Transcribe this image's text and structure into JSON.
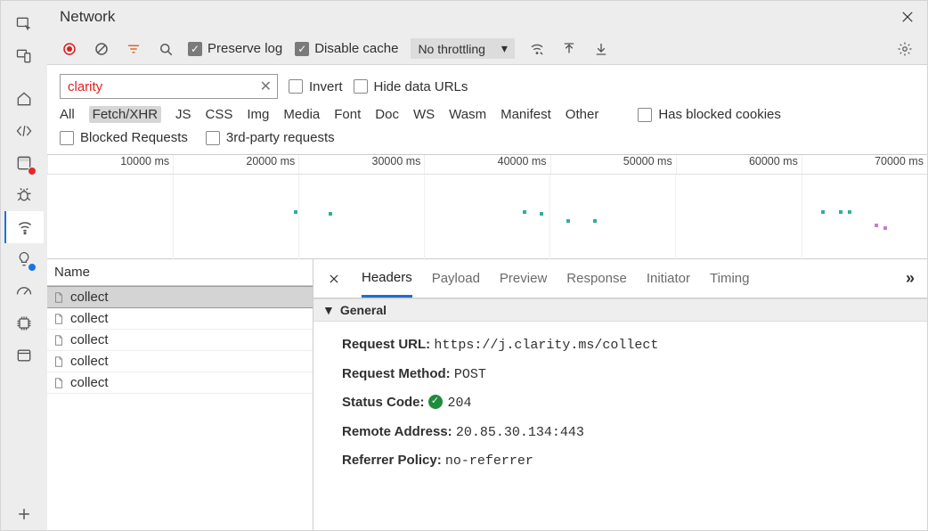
{
  "title": "Network",
  "rail": {
    "items": [
      {
        "name": "inspect-icon"
      },
      {
        "name": "device-icon"
      },
      {
        "name": "home-icon"
      },
      {
        "name": "elements-icon"
      },
      {
        "name": "sources-icon",
        "badge": "red"
      },
      {
        "name": "bug-icon"
      },
      {
        "name": "network-icon",
        "active": true
      },
      {
        "name": "lightbulb-icon",
        "badge": "blue"
      },
      {
        "name": "performance-icon"
      },
      {
        "name": "memory-icon"
      },
      {
        "name": "application-icon"
      },
      {
        "name": "plus-icon"
      }
    ]
  },
  "toolbar": {
    "preserve_log_label": "Preserve log",
    "disable_cache_label": "Disable cache",
    "throttling_label": "No throttling"
  },
  "filter": {
    "value": "clarity",
    "invert_label": "Invert",
    "hide_data_urls_label": "Hide data URLs",
    "has_blocked_cookies_label": "Has blocked cookies",
    "blocked_requests_label": "Blocked Requests",
    "third_party_label": "3rd-party requests",
    "types": [
      "All",
      "Fetch/XHR",
      "JS",
      "CSS",
      "Img",
      "Media",
      "Font",
      "Doc",
      "WS",
      "Wasm",
      "Manifest",
      "Other"
    ],
    "active_type": "Fetch/XHR"
  },
  "waterfall": {
    "ticks": [
      "10000 ms",
      "20000 ms",
      "30000 ms",
      "40000 ms",
      "50000 ms",
      "60000 ms",
      "70000 ms"
    ]
  },
  "name_header": "Name",
  "requests": [
    {
      "name": "collect",
      "selected": true
    },
    {
      "name": "collect"
    },
    {
      "name": "collect"
    },
    {
      "name": "collect"
    },
    {
      "name": "collect"
    }
  ],
  "detail_tabs": [
    "Headers",
    "Payload",
    "Preview",
    "Response",
    "Initiator",
    "Timing"
  ],
  "detail_active_tab": "Headers",
  "headers": {
    "section_title": "General",
    "request_url_label": "Request URL:",
    "request_url_value": "https://j.clarity.ms/collect",
    "request_method_label": "Request Method:",
    "request_method_value": "POST",
    "status_code_label": "Status Code:",
    "status_code_value": "204",
    "remote_addr_label": "Remote Address:",
    "remote_addr_value": "20.85.30.134:443",
    "referrer_label": "Referrer Policy:",
    "referrer_value": "no-referrer"
  }
}
